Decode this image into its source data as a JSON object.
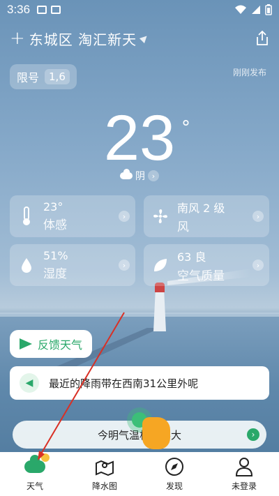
{
  "status_bar": {
    "time": "3:36"
  },
  "header": {
    "location": "东城区 淘汇新天"
  },
  "limit": {
    "label": "限号",
    "numbers": "1,6"
  },
  "publish_text": "刚刚发布",
  "weather": {
    "temperature": "23",
    "degree": "°",
    "condition": "阴"
  },
  "cards": [
    {
      "value": "23°",
      "label": "体感",
      "icon": "thermometer-icon"
    },
    {
      "value": "南风 2 级",
      "label": "风",
      "icon": "fan-icon"
    },
    {
      "value": "51%",
      "label": "湿度",
      "icon": "droplet-icon"
    },
    {
      "value": "63 良",
      "label": "空气质量",
      "icon": "leaf-icon"
    }
  ],
  "feedback_label": "反馈天气",
  "alert_text": "最近的降雨带在西南31公里外呢",
  "tomorrow_text": "今明气温相差不大",
  "tabs": [
    {
      "label": "天气",
      "icon": "weather-cloud-icon",
      "active": true
    },
    {
      "label": "降水图",
      "icon": "map-pin-icon",
      "active": false
    },
    {
      "label": "发现",
      "icon": "compass-icon",
      "active": false
    },
    {
      "label": "未登录",
      "icon": "user-icon",
      "active": false
    }
  ],
  "colors": {
    "accent": "#2aa86a",
    "sky": "#86a9c9"
  }
}
